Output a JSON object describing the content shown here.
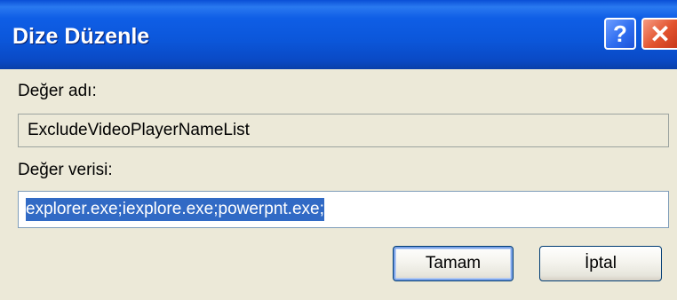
{
  "window": {
    "title": "Dize Düzenle",
    "help_glyph": "?",
    "close_glyph": "✕"
  },
  "fields": {
    "value_name_label": "Değer adı:",
    "value_name": "ExcludeVideoPlayerNameList",
    "value_data_label": "Değer verisi:",
    "value_data": "explorer.exe;iexplore.exe;powerpnt.exe;"
  },
  "buttons": {
    "ok_label": "Tamam",
    "cancel_label": "İptal"
  },
  "colors": {
    "titlebar": "#0a56d9",
    "close_button": "#e2532e",
    "client_background": "#ece9d8",
    "selection": "#316ac5"
  },
  "icons": {
    "help": "help-icon",
    "close": "close-icon"
  }
}
